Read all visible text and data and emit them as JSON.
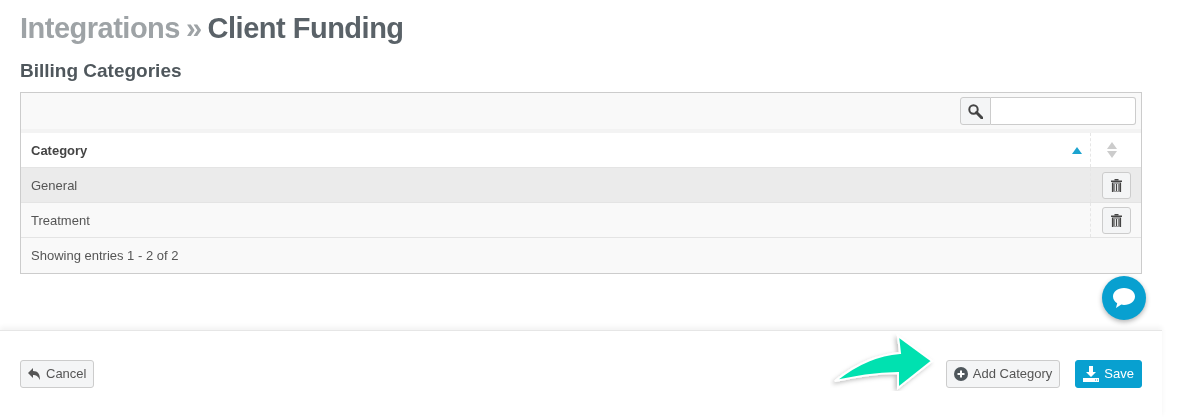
{
  "breadcrumb": {
    "parent": "Integrations",
    "separator": "»",
    "current": "Client Funding"
  },
  "section_title": "Billing Categories",
  "table": {
    "columns": [
      {
        "label": "Category",
        "sorted": true
      },
      {
        "sorted": false
      }
    ],
    "rows": [
      {
        "category": "General",
        "hover": true
      },
      {
        "category": "Treatment",
        "hover": false
      }
    ],
    "info": "Showing entries 1 - 2 of 2"
  },
  "footer_buttons": [
    {
      "kind": "cancel",
      "label": "Cancel"
    },
    {
      "kind": "add",
      "label": "Add Category"
    },
    {
      "kind": "save",
      "label": "Save"
    }
  ]
}
